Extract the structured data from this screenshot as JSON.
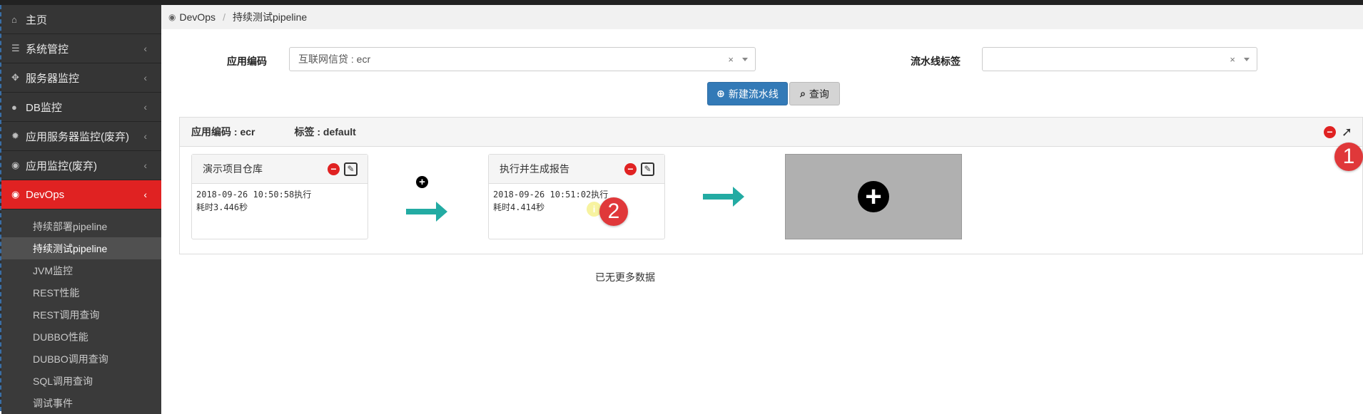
{
  "colors": {
    "accent_red": "#e02222",
    "primary_blue": "#337ab7",
    "arrow_teal": "#23aba3"
  },
  "sidebar": {
    "items": [
      {
        "label": "主页",
        "icon": "home-icon"
      },
      {
        "label": "系统管控",
        "icon": "server-icon"
      },
      {
        "label": "服务器监控",
        "icon": "crosshair-icon"
      },
      {
        "label": "DB监控",
        "icon": "globe-icon"
      },
      {
        "label": "应用服务器监控(废弃)",
        "icon": "gear-icon"
      },
      {
        "label": "应用监控(废弃)",
        "icon": "eye-icon"
      },
      {
        "label": "DevOps",
        "icon": "eye-icon"
      }
    ],
    "subitems": [
      {
        "label": "持续部署pipeline"
      },
      {
        "label": "持续测试pipeline"
      },
      {
        "label": "JVM监控"
      },
      {
        "label": "REST性能"
      },
      {
        "label": "REST调用查询"
      },
      {
        "label": "DUBBO性能"
      },
      {
        "label": "DUBBO调用查询"
      },
      {
        "label": "SQL调用查询"
      },
      {
        "label": "调试事件"
      }
    ]
  },
  "breadcrumb": {
    "root": "DevOps",
    "current": "持续测试pipeline"
  },
  "filters": {
    "app_code_label": "应用编码",
    "app_code_value": "互联网信贷 : ecr",
    "pipeline_tag_label": "流水线标签",
    "pipeline_tag_value": "",
    "clear_symbol": "×"
  },
  "buttons": {
    "new_pipeline": "新建流水线",
    "query": "查询"
  },
  "pipeline": {
    "app_code": "应用编码 : ecr",
    "tag": "标签 : default",
    "stages": [
      {
        "title": "演示项目仓库",
        "line1": "2018-09-26 10:50:58执行",
        "line2": "耗时3.446秒"
      },
      {
        "title": "执行并生成报告",
        "line1": "2018-09-26 10:51:02执行",
        "line2": "耗时4.414秒"
      }
    ]
  },
  "badges": {
    "one": "1",
    "two": "2"
  },
  "footer": {
    "no_more": "已无更多数据"
  }
}
